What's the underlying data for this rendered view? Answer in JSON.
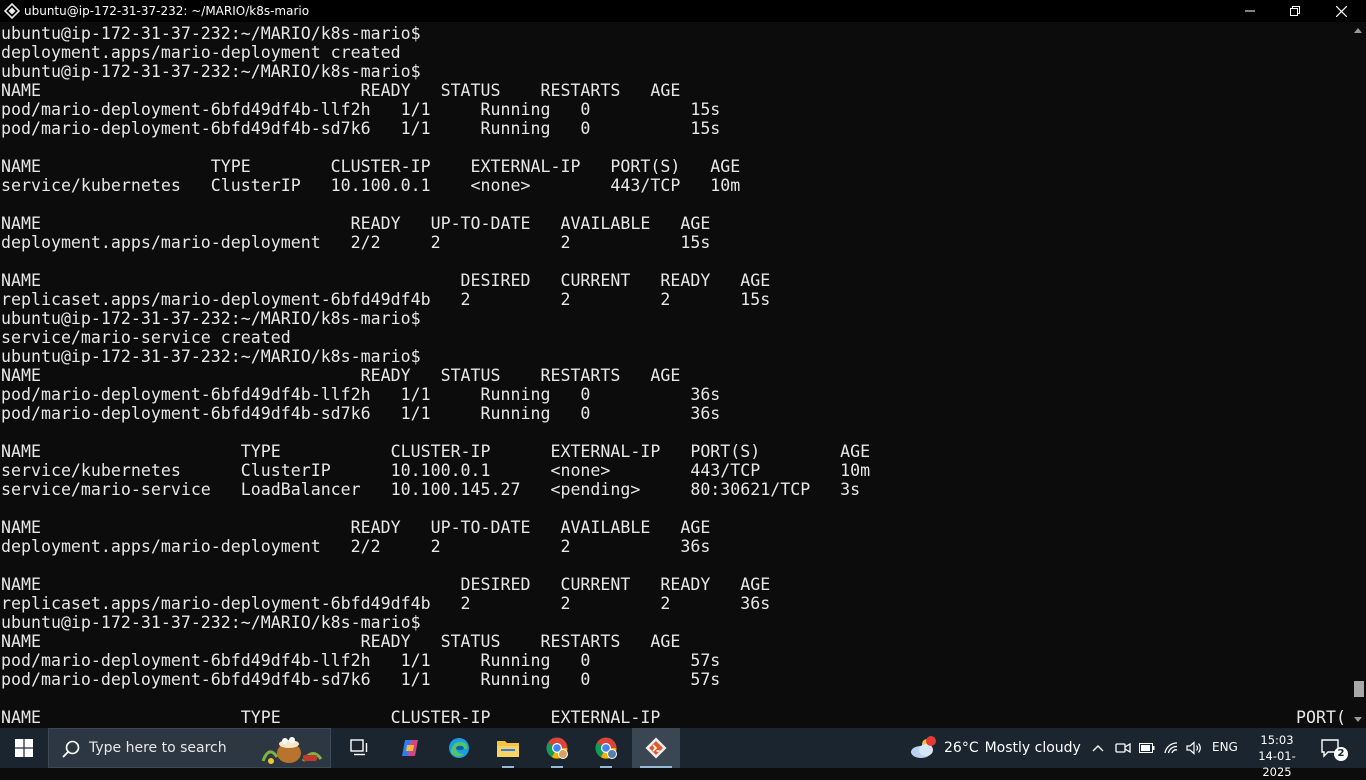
{
  "window": {
    "title": "ubuntu@ip-172-31-37-232: ~/MARIO/k8s-mario",
    "icon": "git-bash-icon"
  },
  "terminal": {
    "lines": [
      "ubuntu@ip-172-31-37-232:~/MARIO/k8s-mario$",
      "deployment.apps/mario-deployment created",
      "ubuntu@ip-172-31-37-232:~/MARIO/k8s-mario$",
      "NAME                                READY   STATUS    RESTARTS   AGE",
      "pod/mario-deployment-6bfd49df4b-llf2h   1/1     Running   0          15s",
      "pod/mario-deployment-6bfd49df4b-sd7k6   1/1     Running   0          15s",
      "",
      "NAME                 TYPE        CLUSTER-IP    EXTERNAL-IP   PORT(S)   AGE",
      "service/kubernetes   ClusterIP   10.100.0.1    <none>        443/TCP   10m",
      "",
      "NAME                               READY   UP-TO-DATE   AVAILABLE   AGE",
      "deployment.apps/mario-deployment   2/2     2            2           15s",
      "",
      "NAME                                          DESIRED   CURRENT   READY   AGE",
      "replicaset.apps/mario-deployment-6bfd49df4b   2         2         2       15s",
      "ubuntu@ip-172-31-37-232:~/MARIO/k8s-mario$",
      "service/mario-service created",
      "ubuntu@ip-172-31-37-232:~/MARIO/k8s-mario$",
      "NAME                                READY   STATUS    RESTARTS   AGE",
      "pod/mario-deployment-6bfd49df4b-llf2h   1/1     Running   0          36s",
      "pod/mario-deployment-6bfd49df4b-sd7k6   1/1     Running   0          36s",
      "",
      "NAME                    TYPE           CLUSTER-IP      EXTERNAL-IP   PORT(S)        AGE",
      "service/kubernetes      ClusterIP      10.100.0.1      <none>        443/TCP        10m",
      "service/mario-service   LoadBalancer   10.100.145.27   <pending>     80:30621/TCP   3s",
      "",
      "NAME                               READY   UP-TO-DATE   AVAILABLE   AGE",
      "deployment.apps/mario-deployment   2/2     2            2           36s",
      "",
      "NAME                                          DESIRED   CURRENT   READY   AGE",
      "replicaset.apps/mario-deployment-6bfd49df4b   2         2         2       36s",
      "ubuntu@ip-172-31-37-232:~/MARIO/k8s-mario$",
      "NAME                                READY   STATUS    RESTARTS   AGE",
      "pod/mario-deployment-6bfd49df4b-llf2h   1/1     Running   0          57s",
      "pod/mario-deployment-6bfd49df4b-sd7k6   1/1     Running   0          57s",
      "",
      "NAME                    TYPE           CLUSTER-IP      EXTERNAL-IP"
    ],
    "last_line_right": "PORT(",
    "text_color": "#e8e8e8",
    "background": "#0c0c0c"
  },
  "taskbar": {
    "search_placeholder": "Type here to search",
    "apps": [
      {
        "name": "task-view-icon"
      },
      {
        "name": "copilot-icon"
      },
      {
        "name": "edge-icon"
      },
      {
        "name": "file-explorer-icon"
      },
      {
        "name": "chrome-icon"
      },
      {
        "name": "chrome-profile-icon"
      },
      {
        "name": "git-bash-icon",
        "active": true
      }
    ],
    "weather": {
      "temp": "26°C",
      "condition": "Mostly cloudy",
      "badge": "1"
    },
    "language": "ENG",
    "time": "15:03",
    "date": "14-01-2025",
    "notification_count": "2"
  }
}
